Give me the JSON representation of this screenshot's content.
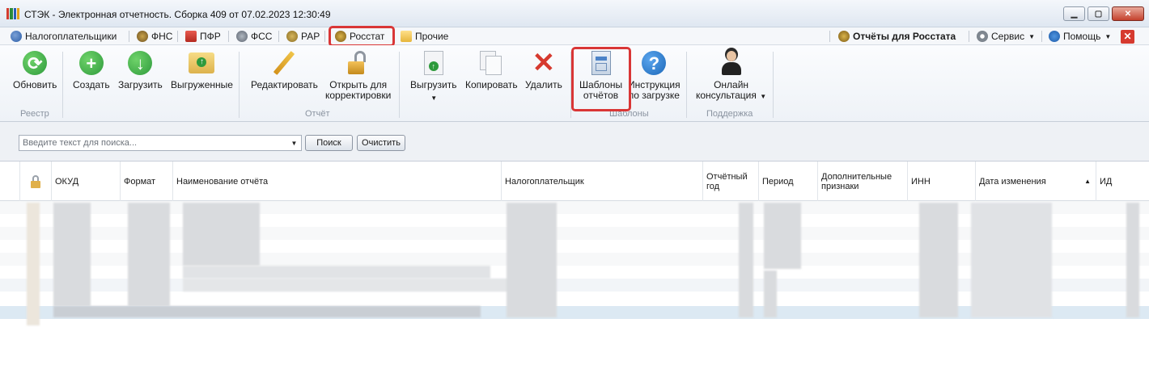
{
  "window": {
    "title": "СТЭК - Электронная отчетность. Сборка 409 от 07.02.2023 12:30:49",
    "controls": [
      "minimize",
      "maximize",
      "close"
    ]
  },
  "menu": {
    "left": [
      {
        "label": "Налогоплательщики",
        "icon": "users-icon"
      },
      {
        "label": "ФНС",
        "icon": "fns-icon"
      },
      {
        "label": "ПФР",
        "icon": "pfr-icon"
      },
      {
        "label": "ФСС",
        "icon": "fss-icon"
      },
      {
        "label": "РАР",
        "icon": "rar-icon"
      },
      {
        "label": "Росстат",
        "icon": "rosstat-icon"
      },
      {
        "label": "Прочие",
        "icon": "folder-icon"
      }
    ],
    "right": [
      {
        "label": "Отчёты для Росстата",
        "icon": "rosstat-icon"
      },
      {
        "label": "Сервис",
        "icon": "gear-icon"
      },
      {
        "label": "Помощь",
        "icon": "help-icon"
      }
    ]
  },
  "ribbon": {
    "buttons": {
      "refresh": "Обновить",
      "create": "Создать",
      "load": "Загрузить",
      "unloaded": "Выгруженные",
      "edit": "Редактировать",
      "open_correct_1": "Открыть для",
      "open_correct_2": "корректировки",
      "export": "Выгрузить",
      "copy": "Копировать",
      "delete": "Удалить",
      "templates_1": "Шаблоны",
      "templates_2": "отчётов",
      "instruction_1": "Инструкция",
      "instruction_2": "по загрузке",
      "consult_1": "Онлайн",
      "consult_2": "консультация"
    },
    "groups": {
      "registry": "Реестр",
      "report": "Отчёт",
      "templates": "Шаблоны",
      "support": "Поддержка"
    }
  },
  "search": {
    "placeholder": "Введите текст для поиска...",
    "search_button": "Поиск",
    "clear_button": "Очистить"
  },
  "grid": {
    "columns": {
      "okud": "ОКУД",
      "format": "Формат",
      "name": "Наименование отчёта",
      "taxpayer": "Налогоплательщик",
      "year_1": "Отчётный",
      "year_2": "год",
      "period": "Период",
      "extra_1": "Дополнительные",
      "extra_2": "признаки",
      "inn": "ИНН",
      "date": "Дата изменения",
      "id": "ИД"
    },
    "sort_indicator": "▲"
  },
  "colors": {
    "highlight": "#d93636",
    "selected_row": "#dce9f3",
    "green_icon": "#2e9a3c",
    "blue_icon": "#1c74c4",
    "red_delete": "#d63a2f"
  }
}
